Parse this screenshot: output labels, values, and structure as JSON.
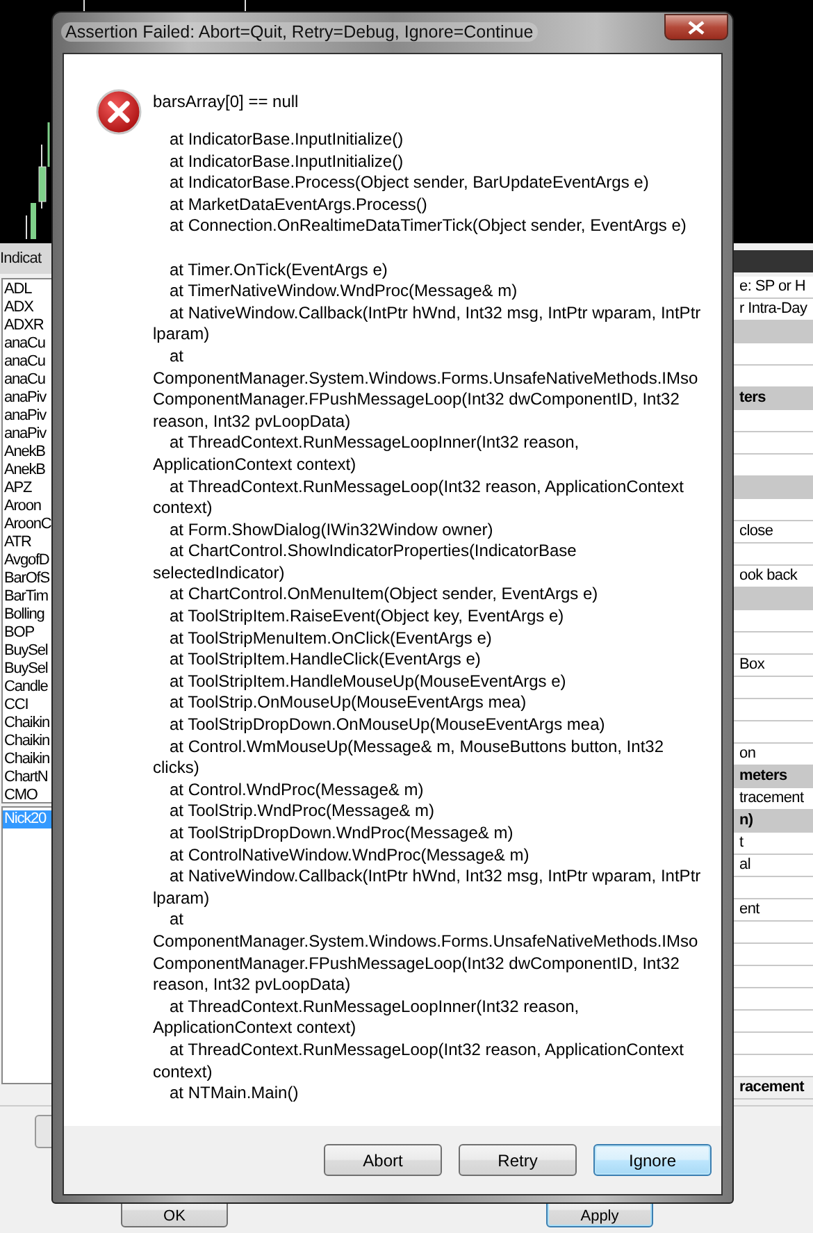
{
  "indicators_panel": {
    "title": "Indicat",
    "items": [
      {
        "label": "ADL",
        "selected": false
      },
      {
        "label": "ADX",
        "selected": false
      },
      {
        "label": "ADXR",
        "selected": false
      },
      {
        "label": "anaCu",
        "selected": false
      },
      {
        "label": "anaCu",
        "selected": false
      },
      {
        "label": "anaCu",
        "selected": false
      },
      {
        "label": "anaPiv",
        "selected": false
      },
      {
        "label": "anaPiv",
        "selected": false
      },
      {
        "label": "anaPiv",
        "selected": false
      },
      {
        "label": "AnekB",
        "selected": false
      },
      {
        "label": "AnekB",
        "selected": false
      },
      {
        "label": "APZ",
        "selected": false
      },
      {
        "label": "Aroon",
        "selected": false
      },
      {
        "label": "AroonC",
        "selected": false
      },
      {
        "label": "ATR",
        "selected": false
      },
      {
        "label": "AvgofD",
        "selected": false
      },
      {
        "label": "BarOfS",
        "selected": false
      },
      {
        "label": "BarTim",
        "selected": false
      },
      {
        "label": "Bolling",
        "selected": false
      },
      {
        "label": "BOP",
        "selected": false
      },
      {
        "label": "BuySel",
        "selected": false
      },
      {
        "label": "BuySel",
        "selected": false
      },
      {
        "label": "Candle",
        "selected": false
      },
      {
        "label": "CCI",
        "selected": false
      },
      {
        "label": "Chaikin",
        "selected": false
      },
      {
        "label": "Chaikin",
        "selected": false
      },
      {
        "label": "Chaikin",
        "selected": false
      },
      {
        "label": "ChartN",
        "selected": false
      },
      {
        "label": "CMO",
        "selected": false
      }
    ],
    "applied": [
      {
        "label": "Nick20",
        "selected": true
      }
    ]
  },
  "properties_panel": {
    "rows": [
      {
        "kind": "row",
        "text": "e: SP or H"
      },
      {
        "kind": "row",
        "text": "r Intra-Day"
      },
      {
        "kind": "category"
      },
      {
        "kind": "row"
      },
      {
        "kind": "row"
      },
      {
        "kind": "category",
        "text": "ters"
      },
      {
        "kind": "row"
      },
      {
        "kind": "row"
      },
      {
        "kind": "row"
      },
      {
        "kind": "category"
      },
      {
        "kind": "row"
      },
      {
        "kind": "row",
        "text": "close"
      },
      {
        "kind": "row"
      },
      {
        "kind": "row",
        "text": "ook back"
      },
      {
        "kind": "category"
      },
      {
        "kind": "row"
      },
      {
        "kind": "row"
      },
      {
        "kind": "row",
        "text": "Box"
      },
      {
        "kind": "row"
      },
      {
        "kind": "row"
      },
      {
        "kind": "row"
      },
      {
        "kind": "row",
        "text": "on"
      },
      {
        "kind": "category",
        "text": "meters"
      },
      {
        "kind": "row",
        "text": "tracement"
      },
      {
        "kind": "category",
        "text": "n)"
      },
      {
        "kind": "row",
        "text": "t"
      },
      {
        "kind": "row",
        "text": "al"
      },
      {
        "kind": "row"
      },
      {
        "kind": "row",
        "text": "ent"
      },
      {
        "kind": "row"
      },
      {
        "kind": "row"
      },
      {
        "kind": "row"
      },
      {
        "kind": "row"
      },
      {
        "kind": "row"
      },
      {
        "kind": "row"
      },
      {
        "kind": "row"
      },
      {
        "kind": "bold",
        "text": "racement"
      }
    ]
  },
  "bottom_buttons": [
    {
      "label": "OK",
      "focused": false
    },
    {
      "label": "Apply",
      "focused": true
    }
  ],
  "dialog": {
    "title": "Assertion Failed: Abort=Quit, Retry=Debug, Ignore=Continue",
    "message": "barsArray[0] == null",
    "stack_groups": [
      [
        "at IndicatorBase.InputInitialize()",
        "at IndicatorBase.InputInitialize()",
        "at IndicatorBase.Process(Object sender, BarUpdateEventArgs e)",
        "at MarketDataEventArgs.Process()",
        "at Connection.OnRealtimeDataTimerTick(Object sender, EventArgs e)"
      ],
      [
        "at Timer.OnTick(EventArgs e)",
        "at TimerNativeWindow.WndProc(Message& m)",
        "at NativeWindow.Callback(IntPtr hWnd, Int32 msg, IntPtr wparam, IntPtr lparam)",
        "at ComponentManager.System.Windows.Forms.UnsafeNativeMethods.IMsoComponentManager.FPushMessageLoop(Int32 dwComponentID, Int32 reason, Int32 pvLoopData)",
        "at ThreadContext.RunMessageLoopInner(Int32 reason, ApplicationContext context)",
        "at ThreadContext.RunMessageLoop(Int32 reason, ApplicationContext context)",
        "at Form.ShowDialog(IWin32Window owner)",
        "at ChartControl.ShowIndicatorProperties(IndicatorBase selectedIndicator)",
        "at ChartControl.OnMenuItem(Object sender, EventArgs e)",
        "at ToolStripItem.RaiseEvent(Object key, EventArgs e)",
        "at ToolStripMenuItem.OnClick(EventArgs e)",
        "at ToolStripItem.HandleClick(EventArgs e)",
        "at ToolStripItem.HandleMouseUp(MouseEventArgs e)",
        "at ToolStrip.OnMouseUp(MouseEventArgs mea)",
        "at ToolStripDropDown.OnMouseUp(MouseEventArgs mea)",
        "at Control.WmMouseUp(Message& m, MouseButtons button, Int32 clicks)",
        "at Control.WndProc(Message& m)",
        "at ToolStrip.WndProc(Message& m)",
        "at ToolStripDropDown.WndProc(Message& m)",
        "at ControlNativeWindow.WndProc(Message& m)",
        "at NativeWindow.Callback(IntPtr hWnd, Int32 msg, IntPtr wparam, IntPtr lparam)",
        "at ComponentManager.System.Windows.Forms.UnsafeNativeMethods.IMsoComponentManager.FPushMessageLoop(Int32 dwComponentID, Int32 reason, Int32 pvLoopData)",
        "at ThreadContext.RunMessageLoopInner(Int32 reason, ApplicationContext context)",
        "at ThreadContext.RunMessageLoop(Int32 reason, ApplicationContext context)",
        "at NTMain.Main()"
      ]
    ],
    "buttons": [
      {
        "label": "Abort",
        "selected": false
      },
      {
        "label": "Retry",
        "selected": false
      },
      {
        "label": "Ignore",
        "selected": true
      }
    ]
  }
}
